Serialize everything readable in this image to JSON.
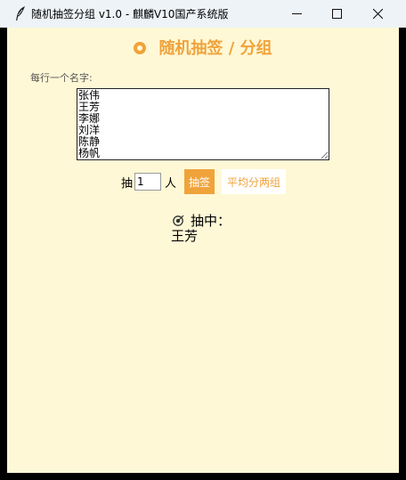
{
  "window": {
    "title": "随机抽签分组  v1.0  -  麒麟V10国产系统版",
    "app_icon": "feather-icon",
    "controls": {
      "minimize_icon": "minimize-icon",
      "maximize_icon": "maximize-icon",
      "close_icon": "close-icon"
    }
  },
  "app": {
    "heading": "随机抽签  /  分组",
    "heading_icon": "dice-icon",
    "accent_color": "#f0a33a",
    "background_color": "#fff8d6"
  },
  "names": {
    "label": "每行一个名字:",
    "value": "张伟\n王芳\n李娜\n刘洋\n陈静\n杨帆"
  },
  "draw": {
    "prefix": "抽",
    "count": "1",
    "suffix": "人",
    "draw_button": "抽签",
    "split_button": "平均分两组"
  },
  "result": {
    "icon": "target-icon",
    "heading": "抽中：",
    "name": "王芳"
  }
}
